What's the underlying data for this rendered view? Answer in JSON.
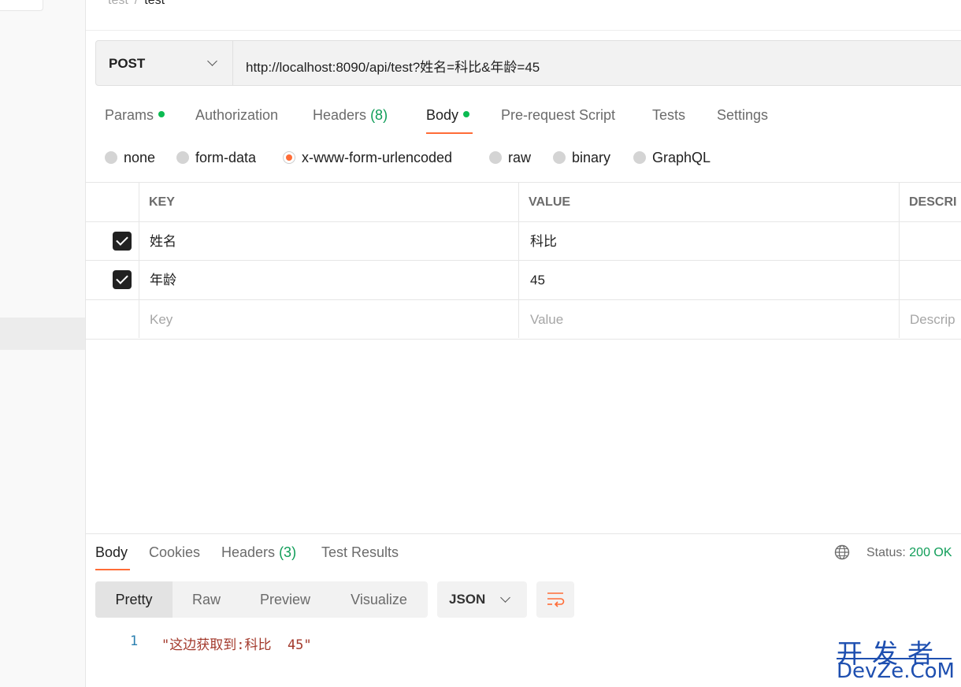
{
  "breadcrumb": {
    "parent": "test",
    "separator": "/",
    "current": "test"
  },
  "request": {
    "method": "POST",
    "url": "http://localhost:8090/api/test?姓名=科比&年龄=45"
  },
  "tabs": [
    {
      "label": "Params",
      "dot": true
    },
    {
      "label": "Authorization"
    },
    {
      "label": "Headers",
      "count": "(8)"
    },
    {
      "label": "Body",
      "dot": true,
      "active": true
    },
    {
      "label": "Pre-request Script"
    },
    {
      "label": "Tests"
    },
    {
      "label": "Settings"
    }
  ],
  "body_types": [
    {
      "label": "none"
    },
    {
      "label": "form-data"
    },
    {
      "label": "x-www-form-urlencoded",
      "selected": true
    },
    {
      "label": "raw"
    },
    {
      "label": "binary"
    },
    {
      "label": "GraphQL"
    }
  ],
  "table": {
    "headers": {
      "key": "KEY",
      "value": "VALUE",
      "description": "DESCRI"
    },
    "rows": [
      {
        "checked": true,
        "key": "姓名",
        "value": "科比"
      },
      {
        "checked": true,
        "key": "年龄",
        "value": "45"
      }
    ],
    "placeholder": {
      "key": "Key",
      "value": "Value",
      "description": "Descrip"
    }
  },
  "response": {
    "tabs": [
      {
        "label": "Body",
        "active": true
      },
      {
        "label": "Cookies"
      },
      {
        "label": "Headers",
        "count": "(3)"
      },
      {
        "label": "Test Results"
      }
    ],
    "status_label": "Status:",
    "status_value": "200 OK",
    "views": [
      "Pretty",
      "Raw",
      "Preview",
      "Visualize"
    ],
    "format": "JSON",
    "lines": [
      {
        "num": "1",
        "text": "\"这边获取到:科比  45\""
      }
    ]
  },
  "watermark": {
    "line1": "开发者",
    "line2": "DevZe.CoM"
  },
  "colors": {
    "accent": "#ff6c37",
    "success": "#0f9d58",
    "dot": "#0cbb52"
  }
}
